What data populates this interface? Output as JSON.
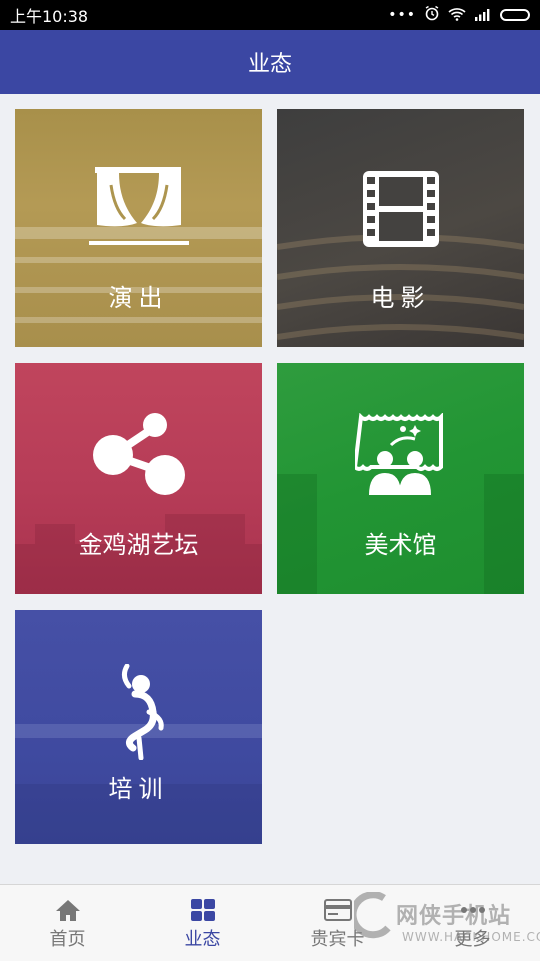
{
  "status_bar": {
    "time": "上午10:38"
  },
  "header": {
    "title": "业态"
  },
  "tiles": [
    {
      "label": "演出",
      "icon": "curtain-icon",
      "color": "#ad954f"
    },
    {
      "label": "电影",
      "icon": "film-icon",
      "color": "#444240"
    },
    {
      "label": "金鸡湖艺坛",
      "icon": "share-icon",
      "color": "#b83e58"
    },
    {
      "label": "美术馆",
      "icon": "art-gallery-icon",
      "color": "#26963a"
    },
    {
      "label": "培训",
      "icon": "dancer-icon",
      "color": "#414ca1"
    }
  ],
  "bottom_nav": {
    "items": [
      {
        "label": "首页",
        "icon": "home-icon",
        "active": false
      },
      {
        "label": "业态",
        "icon": "grid-icon",
        "active": true
      },
      {
        "label": "贵宾卡",
        "icon": "card-icon",
        "active": false
      },
      {
        "label": "更多",
        "icon": "more-icon",
        "active": false
      }
    ]
  },
  "watermark": {
    "title": "网侠手机站",
    "url": "WWW.HACKHOME.COM"
  },
  "colors": {
    "header": "#3b47a3",
    "background": "#eef0f4",
    "active_nav": "#3b47a3"
  }
}
